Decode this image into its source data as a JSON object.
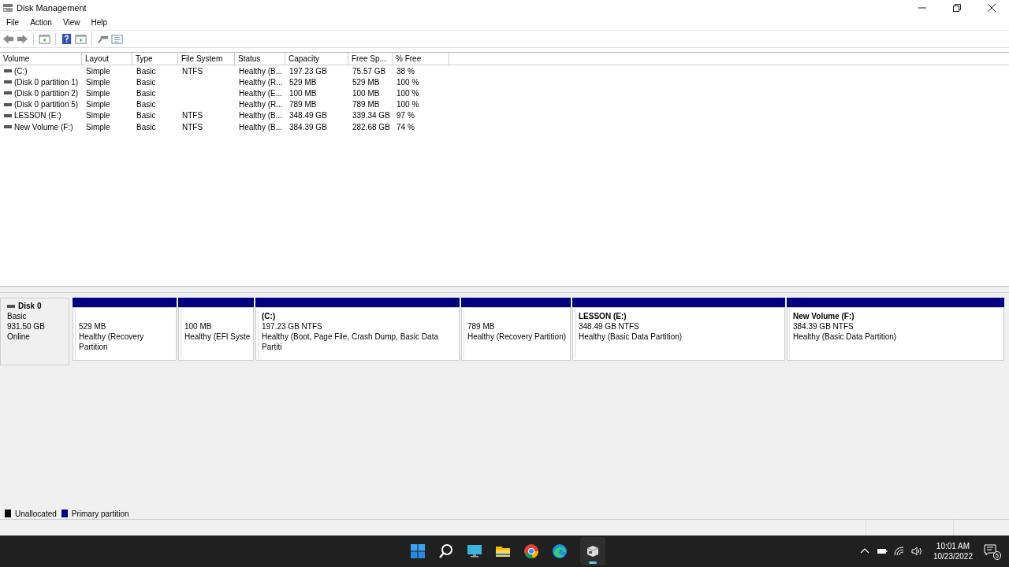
{
  "window": {
    "title": "Disk Management"
  },
  "menu": [
    "File",
    "Action",
    "View",
    "Help"
  ],
  "table": {
    "columns": [
      "Volume",
      "Layout",
      "Type",
      "File System",
      "Status",
      "Capacity",
      "Free Sp...",
      "% Free"
    ],
    "rows": [
      [
        "(C:)",
        "Simple",
        "Basic",
        "NTFS",
        "Healthy (B...",
        "197.23 GB",
        "75.57 GB",
        "38 %"
      ],
      [
        "(Disk 0 partition 1)",
        "Simple",
        "Basic",
        "",
        "Healthy (R...",
        "529 MB",
        "529 MB",
        "100 %"
      ],
      [
        "(Disk 0 partition 2)",
        "Simple",
        "Basic",
        "",
        "Healthy (E...",
        "100 MB",
        "100 MB",
        "100 %"
      ],
      [
        "(Disk 0 partition 5)",
        "Simple",
        "Basic",
        "",
        "Healthy (R...",
        "789 MB",
        "789 MB",
        "100 %"
      ],
      [
        "LESSON (E:)",
        "Simple",
        "Basic",
        "NTFS",
        "Healthy (B...",
        "348.49 GB",
        "339.34 GB",
        "97 %"
      ],
      [
        "New Volume (F:)",
        "Simple",
        "Basic",
        "NTFS",
        "Healthy (B...",
        "384.39 GB",
        "282.68 GB",
        "74 %"
      ]
    ]
  },
  "disk": {
    "name": "Disk 0",
    "type": "Basic",
    "size": "931.50 GB",
    "status": "Online",
    "partitions": [
      {
        "kind": "primary",
        "size": "529 MB",
        "status": "Healthy (Recovery Partition"
      },
      {
        "kind": "primary",
        "size": "100 MB",
        "status": "Healthy (EFI Syste"
      },
      {
        "kind": "primary",
        "label": "(C:)",
        "size": "197.23 GB NTFS",
        "status": "Healthy (Boot, Page File, Crash Dump, Basic Data Partiti"
      },
      {
        "kind": "primary",
        "size": "789 MB",
        "status": "Healthy (Recovery Partition)"
      },
      {
        "kind": "primary",
        "label": "LESSON  (E:)",
        "size": "348.49 GB NTFS",
        "status": "Healthy (Basic Data Partition)"
      },
      {
        "kind": "primary",
        "label": "New Volume  (F:)",
        "size": "384.39 GB NTFS",
        "status": "Healthy (Basic Data Partition)"
      }
    ]
  },
  "legend": [
    {
      "label": "Unallocated",
      "color": "#000000"
    },
    {
      "label": "Primary partition",
      "color": "#000080"
    }
  ],
  "taskbar": {
    "time": "10:01 AM",
    "date": "10/23/2022",
    "notifications": "5"
  }
}
